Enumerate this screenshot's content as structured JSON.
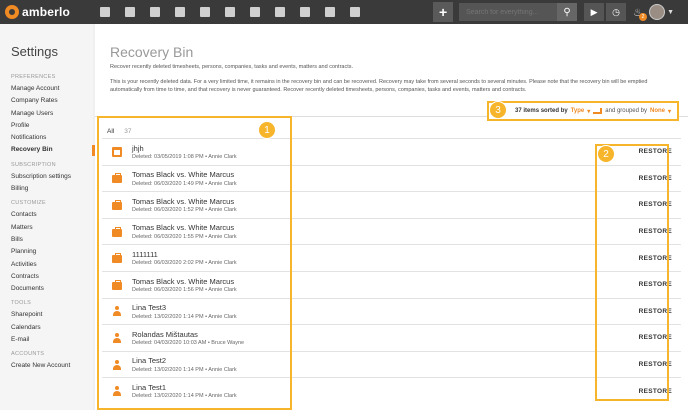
{
  "topbar": {
    "logo_text": "amberlo",
    "nav_icons": [
      "dashboard-icon",
      "contacts-icon",
      "matters-icon",
      "documents-icon",
      "bills-icon",
      "calendar-icon",
      "time-icon",
      "folder-icon",
      "documents-icon",
      "mail-icon",
      "reports-icon"
    ],
    "search_placeholder": "Search for everything...",
    "notification_count": "2"
  },
  "sidebar": {
    "title": "Settings",
    "sections": [
      {
        "heading": "PREFERENCES",
        "items": [
          "Manage Account",
          "Company Rates",
          "Manage Users",
          "Profile",
          "Notifications",
          "Recovery Bin"
        ]
      },
      {
        "heading": "SUBSCRIPTION",
        "items": [
          "Subscription settings",
          "Billing"
        ]
      },
      {
        "heading": "CUSTOMIZE",
        "items": [
          "Contacts",
          "Matters",
          "Bills",
          "Planning",
          "Activities",
          "Contracts",
          "Documents"
        ]
      },
      {
        "heading": "TOOLS",
        "items": [
          "Sharepoint",
          "Calendars",
          "E-mail"
        ]
      },
      {
        "heading": "ACCOUNTS",
        "items": [
          "Create New Account"
        ]
      }
    ],
    "active_item": "Recovery Bin"
  },
  "header": {
    "title": "Recovery Bin",
    "subtitle": "Recover recently deleted timesheets, persons, companies, tasks and events, matters and contracts.",
    "description": "This is your recently deleted data. For a very limited time, it remains in the recovery bin and can be recovered. Recovery may take from several seconds to several minutes. Please note that the recovery bin will be emptied automatically from time to time, and that recovery is never guaranteed. Recover recently deleted timesheets, persons, companies, tasks and events, matters and contracts."
  },
  "sortbar": {
    "count_text": "37 items sorted by",
    "sort_value": "Type",
    "grouped_text": "and grouped by",
    "group_value": "None"
  },
  "tabs": {
    "all_label": "All",
    "all_count": "37"
  },
  "items": [
    {
      "icon": "calendar-icon",
      "name": "jhjh",
      "meta": "Deleted: 03/05/2019 1:08 PM • Annie Clark"
    },
    {
      "icon": "briefcase-icon",
      "name": "Tomas Black vs. White Marcus",
      "meta": "Deleted: 06/03/2020 1:49 PM • Annie Clark"
    },
    {
      "icon": "briefcase-icon",
      "name": "Tomas Black vs. White Marcus",
      "meta": "Deleted: 06/03/2020 1:52 PM • Annie Clark"
    },
    {
      "icon": "briefcase-icon",
      "name": "Tomas Black vs. White Marcus",
      "meta": "Deleted: 06/03/2020 1:55 PM • Annie Clark"
    },
    {
      "icon": "briefcase-icon",
      "name": "1111111",
      "meta": "Deleted: 06/03/2020 2:02 PM • Annie Clark"
    },
    {
      "icon": "briefcase-icon",
      "name": "Tomas Black vs. White Marcus",
      "meta": "Deleted: 06/03/2020 1:56 PM • Annie Clark"
    },
    {
      "icon": "person-icon",
      "name": "Lina Test3",
      "meta": "Deleted: 13/02/2020 1:14 PM • Annie Clark"
    },
    {
      "icon": "person-icon",
      "name": "Rolandas Mištautas",
      "meta": "Deleted: 04/03/2020 10:03 AM • Bruce Wayne"
    },
    {
      "icon": "person-icon",
      "name": "Lina Test2",
      "meta": "Deleted: 13/02/2020 1:14 PM • Annie Clark"
    },
    {
      "icon": "person-icon",
      "name": "Lina Test1",
      "meta": "Deleted: 13/02/2020 1:14 PM • Annie Clark"
    }
  ],
  "restore_label": "RESTORE",
  "callouts": [
    "1",
    "2",
    "3"
  ],
  "colors": {
    "accent": "#f08a24",
    "highlight": "#f6b52a",
    "topbar": "#3a3a3a"
  }
}
